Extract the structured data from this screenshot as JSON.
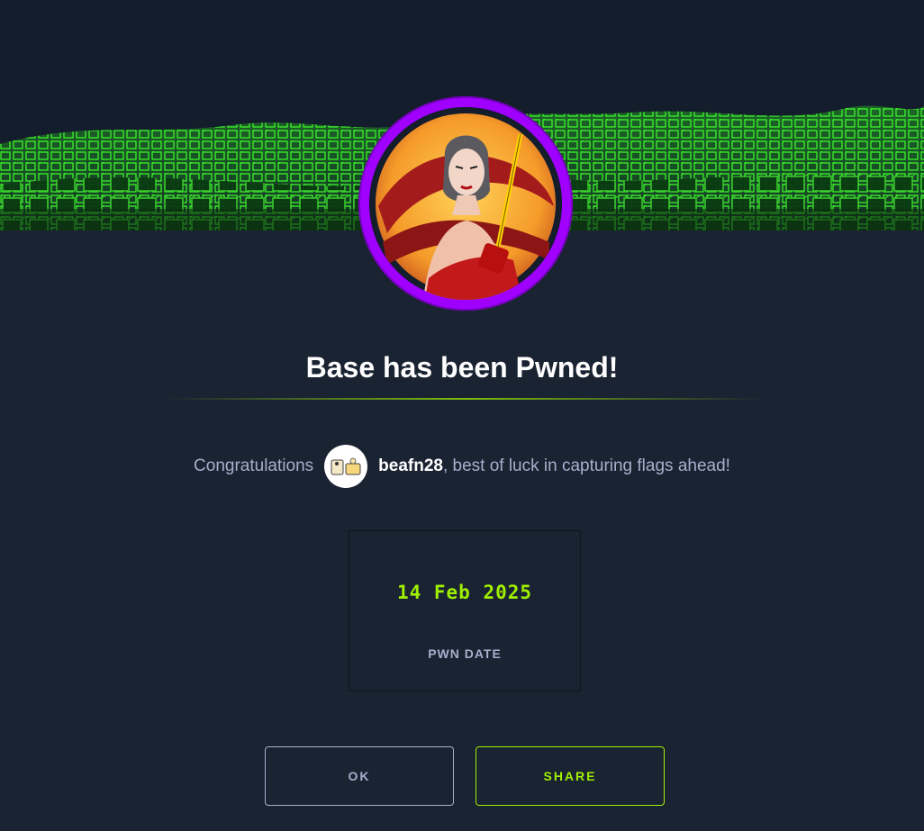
{
  "modal": {
    "title": "Base has been Pwned!",
    "congrats_prefix": "Congratulations",
    "username": "beafn28",
    "congrats_suffix": ", best of luck in capturing flags ahead!",
    "stat": {
      "value": "14 Feb 2025",
      "label": "PWN DATE"
    },
    "buttons": {
      "ok_label": "OK",
      "share_label": "SHARE"
    }
  },
  "colors": {
    "background": "#1a2332",
    "accent_green": "#9fef00",
    "avatar_ring": "#9f00ff",
    "muted_text": "#a4b1cd"
  },
  "icons": {
    "banner": "green-cube-wave-banner",
    "machine_avatar": "woman-with-sword-avatar",
    "user_avatar": "user-avatar-icon"
  }
}
